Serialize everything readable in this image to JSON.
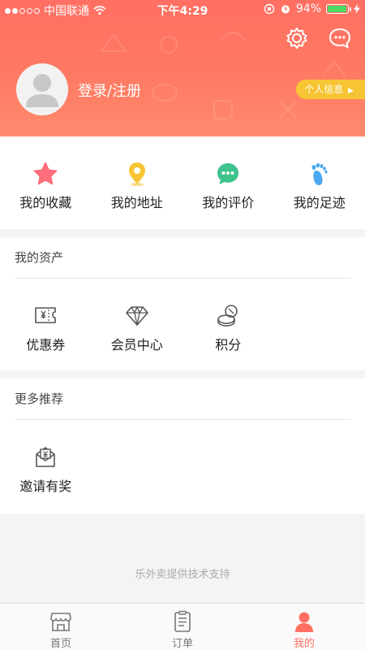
{
  "status_bar": {
    "carrier": "中国联通",
    "time": "下午4:29",
    "battery": "94%",
    "battery_level": 0.94
  },
  "header": {
    "login_label": "登录/注册",
    "profile_label": "个人信息"
  },
  "shortcuts": [
    {
      "label": "我的收藏",
      "icon": "star-icon"
    },
    {
      "label": "我的地址",
      "icon": "location-pin-icon"
    },
    {
      "label": "我的评价",
      "icon": "comment-icon"
    },
    {
      "label": "我的足迹",
      "icon": "footprint-icon"
    }
  ],
  "assets": {
    "title": "我的资产",
    "items": [
      {
        "label": "优惠券",
        "icon": "coupon-icon"
      },
      {
        "label": "会员中心",
        "icon": "diamond-icon"
      },
      {
        "label": "积分",
        "icon": "coins-icon"
      }
    ]
  },
  "more": {
    "title": "更多推荐",
    "items": [
      {
        "label": "邀请有奖",
        "icon": "invite-gift-icon"
      }
    ]
  },
  "footer": "乐外卖提供技术支持",
  "tabbar": {
    "tabs": [
      {
        "label": "首页",
        "icon": "store-icon",
        "active": false
      },
      {
        "label": "订单",
        "icon": "order-list-icon",
        "active": false
      },
      {
        "label": "我的",
        "icon": "person-icon",
        "active": true
      }
    ]
  },
  "colors": {
    "accent": "#ff6f63",
    "badge": "#f7c533"
  }
}
